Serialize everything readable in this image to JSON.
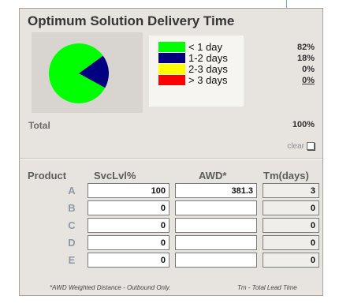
{
  "title": "Optimum Solution Delivery Time",
  "legend": [
    {
      "label": "< 1 day",
      "color": "#00ff00",
      "pct": "82%",
      "value": 82
    },
    {
      "label": "1-2 days",
      "color": "#000080",
      "pct": "18%",
      "value": 18
    },
    {
      "label": "2-3 days",
      "color": "#ffff00",
      "pct": "0%",
      "value": 0
    },
    {
      "label": "> 3 days",
      "color": "#ff0000",
      "pct": "0%",
      "value": 0
    }
  ],
  "total": {
    "label": "Total",
    "value": "100%"
  },
  "clear_label": "clear",
  "table": {
    "headers": [
      "Product",
      "SvcLvl%",
      "AWD*",
      "Tm(days)"
    ],
    "rows": [
      {
        "product": "A",
        "svclvl": "100",
        "awd": "381.3",
        "tm": "3"
      },
      {
        "product": "B",
        "svclvl": "0",
        "awd": "",
        "tm": "0"
      },
      {
        "product": "C",
        "svclvl": "0",
        "awd": "",
        "tm": "0"
      },
      {
        "product": "D",
        "svclvl": "0",
        "awd": "",
        "tm": "0"
      },
      {
        "product": "E",
        "svclvl": "0",
        "awd": "",
        "tm": "0"
      }
    ]
  },
  "footnotes": {
    "awd": "*AWD Weighted Distance - Outbound Only.",
    "tm": "Tm - Total Lead Time"
  }
}
